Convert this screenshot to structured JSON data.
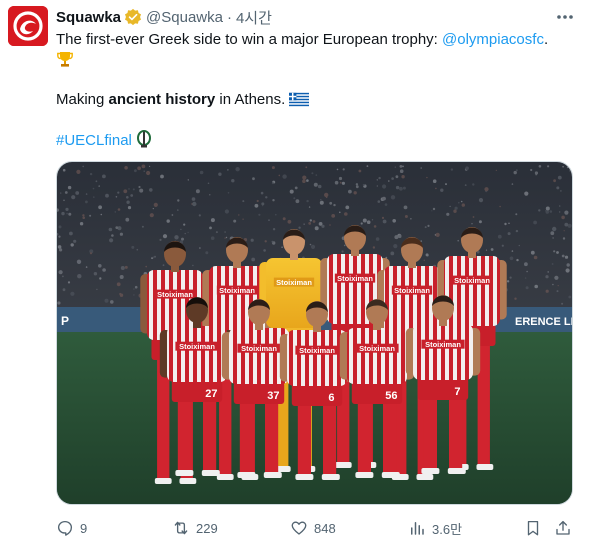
{
  "tweet": {
    "author_name": "Squawka",
    "author_handle": "@Squawka",
    "separator": "·",
    "time": "4시간",
    "line1_text": "The first-ever Greek side to win a major European trophy: ",
    "line1_mention": "@olympiacosfc",
    "line1_end": ".",
    "line2_emoji": "trophy-icon",
    "line3_pre": "Making ",
    "line3_bold": "ancient history",
    "line3_post": " in Athens. ",
    "line3_flag": "greece-flag-icon",
    "hashtag": "#UECLfinal",
    "hashtag_emoji": "uecl-trophy-icon",
    "media_description": "Olympiacos team photo"
  },
  "photo": {
    "sponsor": "Stoiximan",
    "shirt_numbers": [
      "27",
      "37",
      "6",
      "56",
      "7"
    ],
    "banner_left": "P",
    "banner_right": "ERENCE LE"
  },
  "actions": {
    "replies": "9",
    "reposts": "229",
    "likes": "848",
    "views": "3.6만"
  },
  "colors": {
    "brand": "#d71920",
    "link": "#1d9bf0",
    "muted": "#536471",
    "verified": "#e8b829"
  }
}
